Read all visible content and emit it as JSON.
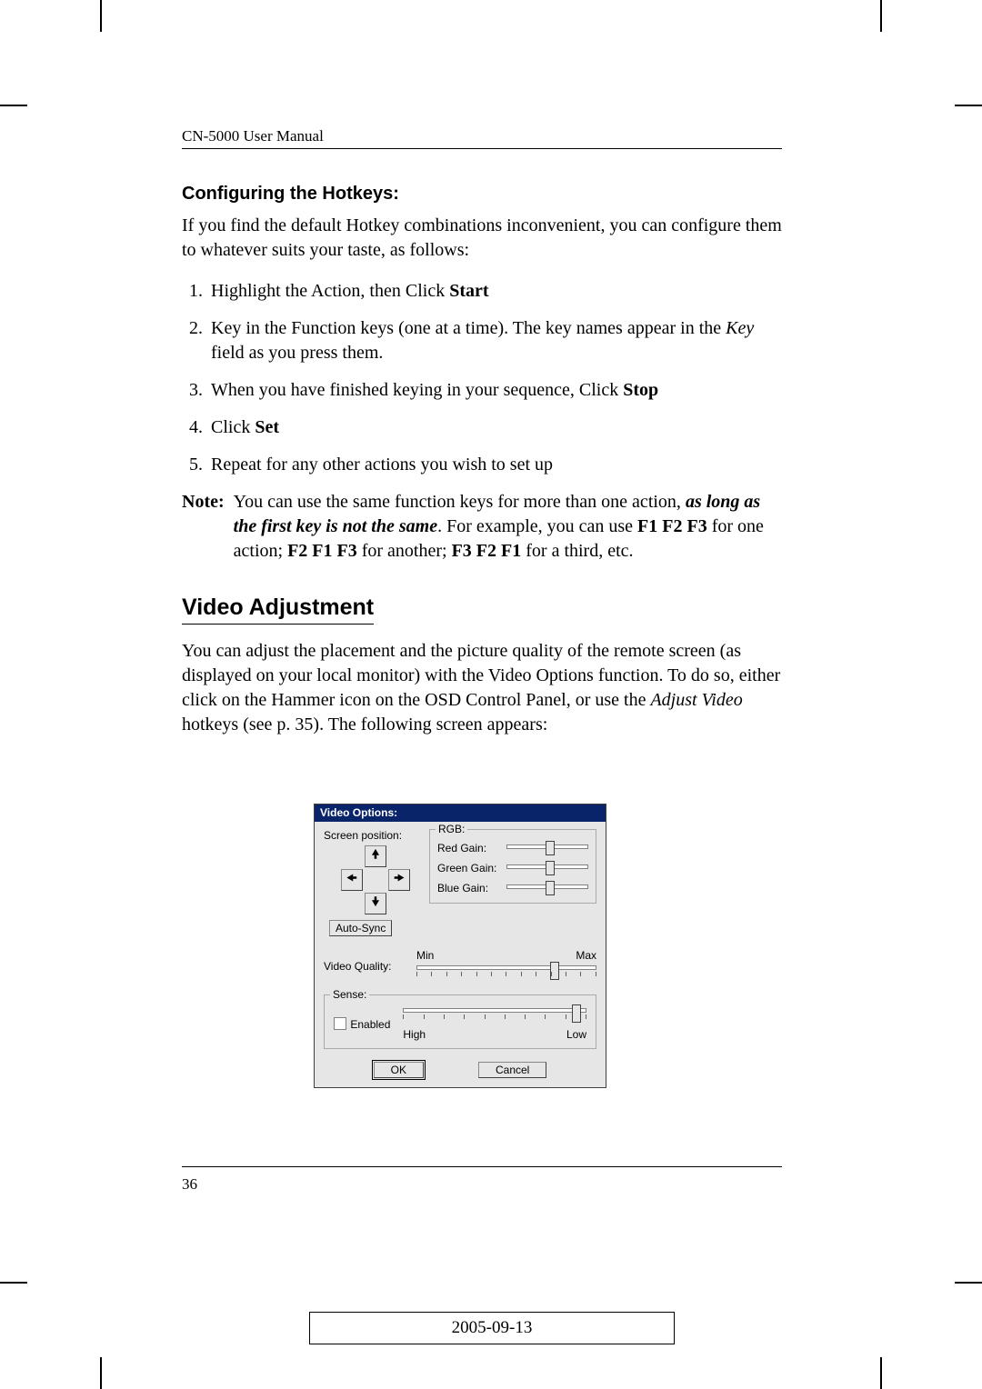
{
  "header": {
    "running": "CN-5000 User Manual"
  },
  "hotkeys": {
    "heading": "Configuring the Hotkeys:",
    "intro": "If you find the default Hotkey combinations inconvenient, you can configure them to whatever suits your taste, as follows:",
    "steps": {
      "s1a": "Highlight the Action, then Click ",
      "s1b": "Start",
      "s2a": "Key in the Function keys (one at a time). The key names appear in the ",
      "s2key": "Key",
      "s2b": " field as you press them.",
      "s3a": "When you have finished keying in your sequence, Click ",
      "s3b": "Stop",
      "s4a": "Click ",
      "s4b": "Set",
      "s5": "Repeat for any other actions you wish to set up"
    },
    "note": {
      "label": "Note:",
      "t1": "You can use the same function keys for more than one action, ",
      "em1": "as long as the first key is not the same",
      "t2": ". For example, you can use ",
      "b1": "F1 F2 F3",
      "t3": " for one action; ",
      "b2": "F2 F1 F3",
      "t4": " for another; ",
      "b3": "F3 F2 F1",
      "t5": " for a third, etc."
    }
  },
  "video": {
    "heading": "Video Adjustment",
    "p1a": "You can adjust the placement and the picture quality of the remote screen (as displayed on your local monitor) with the Video Options function. To do so, either click on the Hammer icon on the OSD Control Panel, or use the ",
    "p1em": "Adjust Video",
    "p1b": " hotkeys (see p. 35). The following screen appears:"
  },
  "dialog": {
    "title": "Video Options:",
    "screen_position": "Screen position:",
    "auto_sync": "Auto-Sync",
    "rgb": "RGB:",
    "red": "Red Gain:",
    "green": "Green Gain:",
    "blue": "Blue Gain:",
    "min": "Min",
    "max": "Max",
    "vq": "Video Quality:",
    "sense": "Sense:",
    "enabled": "Enabled",
    "high": "High",
    "low": "Low",
    "ok": "OK",
    "cancel": "Cancel"
  },
  "footer": {
    "page": "36",
    "date": "2005-09-13"
  }
}
